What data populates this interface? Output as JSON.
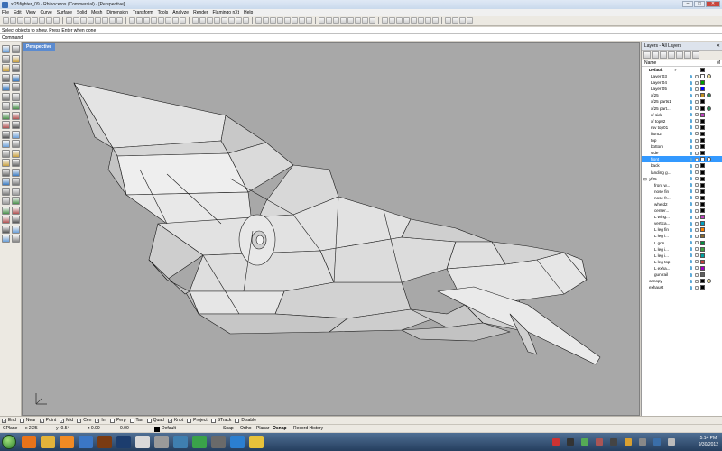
{
  "window": {
    "title": "xf25fighter_09 - Rhinoceros (Commercial) - [Perspective]",
    "controls": [
      "–",
      "□",
      "✕"
    ]
  },
  "menu": [
    "File",
    "Edit",
    "View",
    "Curve",
    "Surface",
    "Solid",
    "Mesh",
    "Dimension",
    "Transform",
    "Tools",
    "Analyze",
    "Render",
    "Flamingo nXt",
    "Help"
  ],
  "command": {
    "history": "Select objects to show. Press Enter when done",
    "prompt": "Command",
    "value": ""
  },
  "viewport": {
    "tab_label": "Perspective"
  },
  "layers_panel": {
    "title": "Layers - All Layers",
    "close_glyph": "✕",
    "col_name": "Name",
    "col_material": "M",
    "rows": [
      {
        "name": "Default",
        "bold": true,
        "current": true,
        "color": "#000000",
        "indent": 0,
        "mat": ""
      },
      {
        "name": "Layer 03",
        "color": "#ffffff",
        "indent": 1,
        "mat": "#f5e6a0"
      },
      {
        "name": "Layer 04",
        "color": "#00a000",
        "indent": 1,
        "mat": ""
      },
      {
        "name": "Layer 05",
        "color": "#0000ff",
        "indent": 1,
        "mat": ""
      },
      {
        "name": "xf25",
        "color": "#c09020",
        "indent": 1,
        "mat": "#2e8b57"
      },
      {
        "name": "xf25 parts1",
        "color": "#000000",
        "indent": 1,
        "mat": ""
      },
      {
        "name": "xf25 part...",
        "color": "#000000",
        "indent": 1,
        "mat": "#2e8b57"
      },
      {
        "name": "xf side",
        "color": "#c040c0",
        "indent": 1,
        "mat": ""
      },
      {
        "name": "xf top02",
        "color": "#000000",
        "indent": 1,
        "mat": ""
      },
      {
        "name": "ruv top01",
        "color": "#000000",
        "indent": 1,
        "mat": ""
      },
      {
        "name": "front2",
        "color": "#000000",
        "indent": 1,
        "mat": ""
      },
      {
        "name": "top",
        "color": "#000000",
        "indent": 1,
        "mat": ""
      },
      {
        "name": "bottom",
        "color": "#000000",
        "indent": 1,
        "mat": ""
      },
      {
        "name": "side",
        "color": "#000000",
        "indent": 1,
        "mat": ""
      },
      {
        "name": "front",
        "color": "#ffffff",
        "indent": 1,
        "mat": "#ffffff",
        "selected": true
      },
      {
        "name": "back",
        "color": "#000000",
        "indent": 1,
        "mat": ""
      },
      {
        "name": "landing g...",
        "color": "#000000",
        "indent": 1,
        "mat": ""
      },
      {
        "name": "yf25",
        "color": "#000000",
        "indent": 0,
        "mat": "",
        "expander": "⊟"
      },
      {
        "name": "front w...",
        "color": "#000000",
        "indent": 2,
        "mat": ""
      },
      {
        "name": "nose fin",
        "color": "#000000",
        "indent": 2,
        "mat": ""
      },
      {
        "name": "nose fr...",
        "color": "#000000",
        "indent": 2,
        "mat": ""
      },
      {
        "name": "wheld2",
        "color": "#000000",
        "indent": 2,
        "mat": ""
      },
      {
        "name": "center...",
        "color": "#000000",
        "indent": 2,
        "mat": ""
      },
      {
        "name": "L wing...",
        "color": "#c040c0",
        "indent": 2,
        "mat": ""
      },
      {
        "name": "vertica...",
        "color": "#00a0c0",
        "indent": 2,
        "mat": ""
      },
      {
        "name": "L leg fin",
        "color": "#ff8000",
        "indent": 2,
        "mat": ""
      },
      {
        "name": "L leg i...",
        "color": "#8a6a30",
        "indent": 2,
        "mat": ""
      },
      {
        "name": "L gnn",
        "color": "#009040",
        "indent": 2,
        "mat": ""
      },
      {
        "name": "L leg i...",
        "color": "#40a040",
        "indent": 2,
        "mat": ""
      },
      {
        "name": "L leg i...",
        "color": "#00a0a0",
        "indent": 2,
        "mat": ""
      },
      {
        "name": "L leg top",
        "color": "#c04040",
        "indent": 2,
        "mat": ""
      },
      {
        "name": "L exha...",
        "color": "#a000c0",
        "indent": 2,
        "mat": ""
      },
      {
        "name": "gun rail",
        "color": "#606060",
        "indent": 2,
        "mat": ""
      },
      {
        "name": "canopy",
        "color": "#000000",
        "indent": 0,
        "mat": "#f5e6a0"
      },
      {
        "name": "exhaust",
        "color": "#000000",
        "indent": 0,
        "mat": ""
      }
    ]
  },
  "osnap": {
    "items": [
      {
        "label": "End",
        "checked": true
      },
      {
        "label": "Near",
        "checked": false
      },
      {
        "label": "Point",
        "checked": true
      },
      {
        "label": "Mid",
        "checked": true
      },
      {
        "label": "Cen",
        "checked": true
      },
      {
        "label": "Int",
        "checked": true
      },
      {
        "label": "Perp",
        "checked": false
      },
      {
        "label": "Tan",
        "checked": false
      },
      {
        "label": "Quad",
        "checked": false
      },
      {
        "label": "Knot",
        "checked": true
      },
      {
        "label": "Project",
        "checked": false
      },
      {
        "label": "STrack",
        "checked": false
      },
      {
        "label": "Disable",
        "checked": false
      }
    ]
  },
  "status": {
    "cplane": "CPlane",
    "x": "x 2.25",
    "y": "y -0.54",
    "z": "z 0.00",
    "extra": "0.00",
    "layer": "Default",
    "toggles": [
      "Snap",
      "Ortho",
      "Planar",
      "Osnap",
      "Record History"
    ]
  },
  "taskbar": {
    "apps": [
      {
        "name": "firefox",
        "color": "#e8731a"
      },
      {
        "name": "explorer",
        "color": "#e3b33a"
      },
      {
        "name": "media-player",
        "color": "#f08a24"
      },
      {
        "name": "windows-media",
        "color": "#3b77c6"
      },
      {
        "name": "illustrator",
        "color": "#7a3b12"
      },
      {
        "name": "photoshop",
        "color": "#1c3d6e"
      },
      {
        "name": "google",
        "color": "#d9d9d9"
      },
      {
        "name": "stacking-app",
        "color": "#9a9a9a"
      },
      {
        "name": "music-app",
        "color": "#3f7fb0"
      },
      {
        "name": "chrome",
        "color": "#3aa24a"
      },
      {
        "name": "rhino-app",
        "color": "#6a6a6a"
      },
      {
        "name": "ie",
        "color": "#2b7fd0"
      },
      {
        "name": "notes",
        "color": "#e8c23a"
      }
    ],
    "clock_time": "5:14 PM",
    "clock_date": "9/30/2012"
  }
}
